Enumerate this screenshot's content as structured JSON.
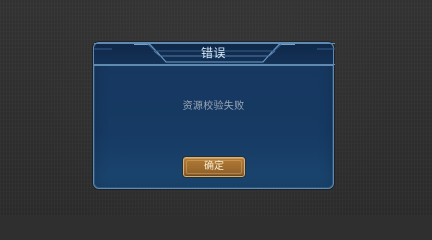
{
  "dialog": {
    "title": "错误",
    "message": "资源校验失败",
    "confirm_label": "确定"
  },
  "colors": {
    "background": "#2f2f2f",
    "panel": "#163a63",
    "border": "#5f8ab1",
    "button": "#9f6c2f",
    "button_border": "#d8b06b"
  }
}
